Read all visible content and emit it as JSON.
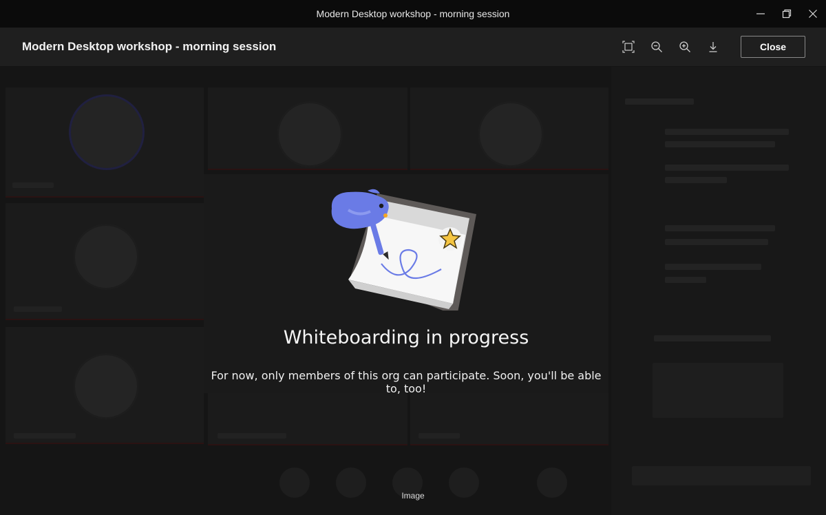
{
  "window": {
    "title": "Modern Desktop workshop - morning session",
    "controls": [
      "minimize-icon",
      "restore-icon",
      "close-icon"
    ]
  },
  "viewer": {
    "title": "Modern Desktop workshop - morning session",
    "tools": [
      "fit-to-frame-icon",
      "zoom-out-icon",
      "zoom-in-icon",
      "download-icon"
    ],
    "close_label": "Close"
  },
  "dialog": {
    "headline": "Whiteboarding in progress",
    "message": "For now, only members of this org can participate. Soon, you'll be able to, too!",
    "illustration": "whiteboard-bird-illustration"
  },
  "caption": "Image",
  "colors": {
    "titlebar_bg": "#0b0b0b",
    "header_bg": "#1f1f1f",
    "card_bg": "#1a1a1a",
    "bird_blue": "#6a7be6",
    "star_yellow": "#f5c542"
  }
}
